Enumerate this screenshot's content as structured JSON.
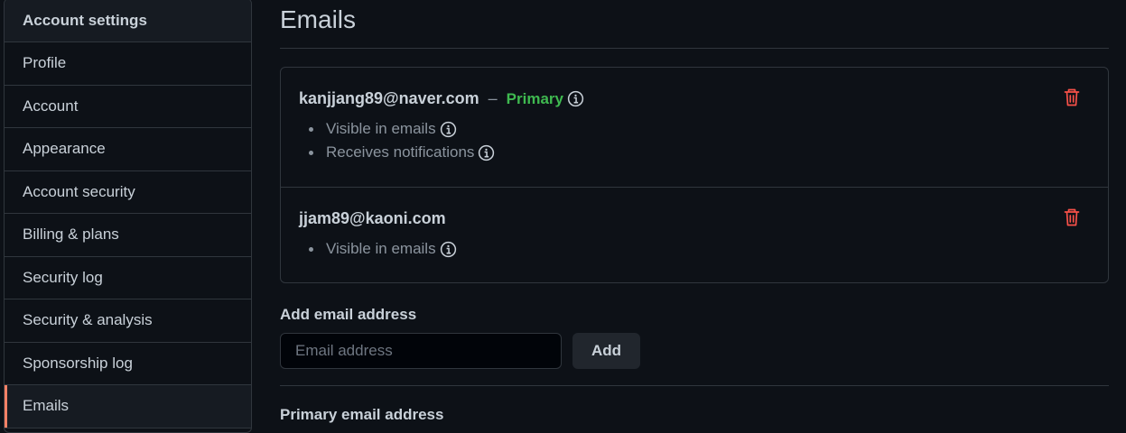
{
  "sidebar": {
    "header": "Account settings",
    "items": [
      {
        "label": "Profile"
      },
      {
        "label": "Account"
      },
      {
        "label": "Appearance"
      },
      {
        "label": "Account security"
      },
      {
        "label": "Billing & plans"
      },
      {
        "label": "Security log"
      },
      {
        "label": "Security & analysis"
      },
      {
        "label": "Sponsorship log"
      },
      {
        "label": "Emails"
      }
    ],
    "active_item": "Emails"
  },
  "main": {
    "title": "Emails",
    "emails": [
      {
        "address": "kanjjang89@naver.com",
        "separator": "–",
        "badge": "Primary",
        "properties": [
          "Visible in emails",
          "Receives notifications"
        ]
      },
      {
        "address": "jjam89@kaoni.com",
        "properties": [
          "Visible in emails"
        ]
      }
    ],
    "add_email": {
      "label": "Add email address",
      "placeholder": "Email address",
      "value": "",
      "button_label": "Add"
    },
    "primary_email_label": "Primary email address"
  },
  "colors": {
    "background": "#0d1117",
    "border": "#30363d",
    "primary_badge": "#3fb950",
    "delete_icon": "#f85149",
    "active_accent": "#f78166"
  },
  "icons": {
    "info": "info-icon",
    "delete": "trash-icon"
  }
}
